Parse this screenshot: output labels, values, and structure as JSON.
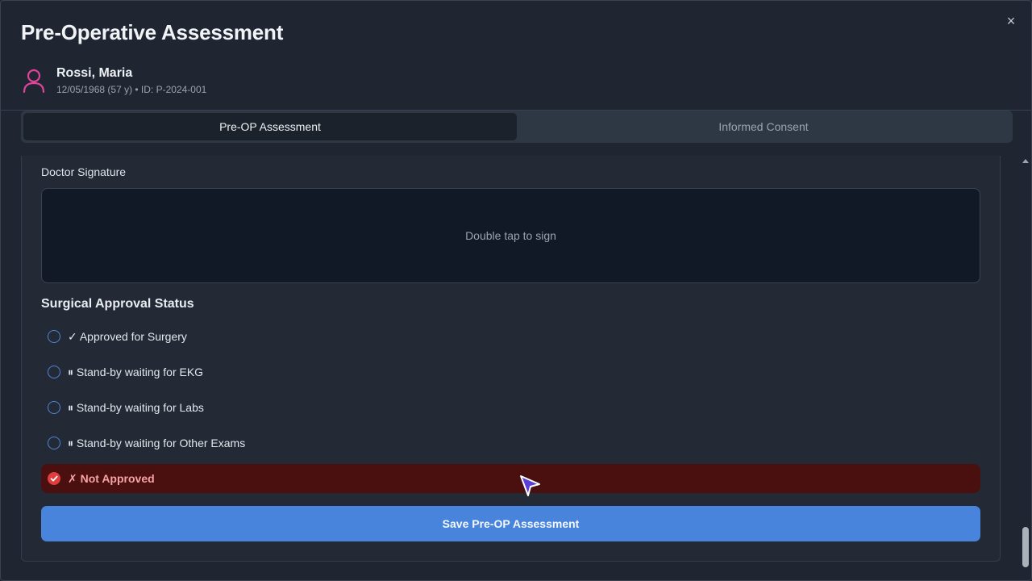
{
  "modal": {
    "title": "Pre-Operative Assessment",
    "close_symbol": "×"
  },
  "patient": {
    "name": "Rossi, Maria",
    "meta": "12/05/1968 (57 y) • ID: P-2024-001",
    "icon": "user-icon"
  },
  "tabs": [
    {
      "label": "Pre-OP Assessment",
      "active": true
    },
    {
      "label": "Informed Consent",
      "active": false
    }
  ],
  "signature": {
    "label": "Doctor Signature",
    "placeholder": "Double tap to sign"
  },
  "approval": {
    "title": "Surgical Approval Status",
    "options": [
      {
        "label": "✓ Approved for Surgery",
        "selected": false
      },
      {
        "label": "⏸ Stand-by waiting for EKG",
        "selected": false
      },
      {
        "label": "⏸ Stand-by waiting for Labs",
        "selected": false
      },
      {
        "label": "⏸ Stand-by waiting for Other Exams",
        "selected": false
      },
      {
        "label": "✗ Not Approved",
        "selected": true
      }
    ]
  },
  "save_button": {
    "label": "Save Pre-OP Assessment"
  },
  "colors": {
    "accent": "#4884dc",
    "patient_icon": "#e0449a",
    "not_approved_bg": "#4a0f0f",
    "not_approved_text": "#f5a3a3",
    "check_red": "#e03e3e"
  }
}
